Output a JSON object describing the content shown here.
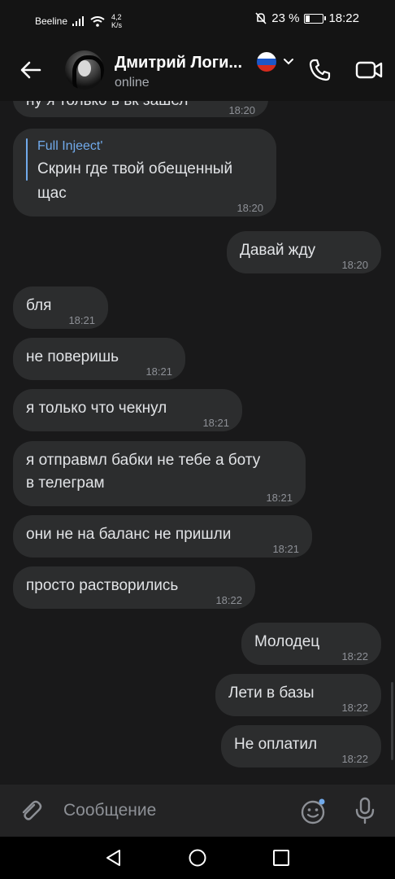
{
  "status_bar": {
    "carrier": "Beeline",
    "net_speed": "4,2",
    "net_unit": "K/s",
    "battery": "23 %",
    "clock": "18:22"
  },
  "header": {
    "name": "Дмитрий Логи...",
    "status": "online"
  },
  "messages": [
    {
      "text": "ну я только в вк зашел",
      "time": "18:20",
      "side": "in"
    },
    {
      "reply_to": "Full Injeect'",
      "line1": "Скрин где твой обещенный",
      "line2": "щас",
      "time": "18:20",
      "side": "in"
    },
    {
      "text": "Давай жду",
      "time": "18:20",
      "side": "out"
    },
    {
      "text": "бля",
      "time": "18:21",
      "side": "in"
    },
    {
      "text": "не поверишь",
      "time": "18:21",
      "side": "in"
    },
    {
      "text": "я только что чекнул",
      "time": "18:21",
      "side": "in"
    },
    {
      "line1": "я отправмл бабки не тебе а боту",
      "line2": "в телеграм",
      "time": "18:21",
      "side": "in"
    },
    {
      "text": "они не на баланс не пришли",
      "time": "18:21",
      "side": "in"
    },
    {
      "text": "просто растворились",
      "time": "18:22",
      "side": "in"
    },
    {
      "text": "Молодец",
      "time": "18:22",
      "side": "out"
    },
    {
      "text": "Лети в базы",
      "time": "18:22",
      "side": "out"
    },
    {
      "text": "Не оплатил",
      "time": "18:22",
      "side": "out"
    }
  ],
  "composer": {
    "placeholder": "Сообщение"
  },
  "colors": {
    "background": "#19191a",
    "bubble": "#2c2d2e",
    "accent": "#71aaeb",
    "time": "#8d9096"
  },
  "icons": [
    "back-arrow-icon",
    "chevron-down-icon",
    "phone-icon",
    "video-camera-icon",
    "paperclip-icon",
    "emoji-icon",
    "microphone-icon",
    "nav-back-icon",
    "nav-home-icon",
    "nav-recent-icon"
  ]
}
